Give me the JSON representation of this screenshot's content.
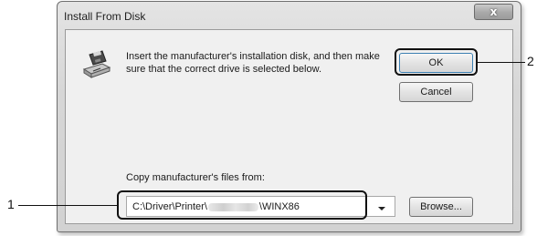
{
  "dialog": {
    "title": "Install From Disk",
    "close_glyph": "x",
    "instruction": "Insert the manufacturer's installation disk, and then make sure that the correct drive is selected below.",
    "ok_label": "OK",
    "cancel_label": "Cancel",
    "copy_label": "Copy manufacturer's files from:",
    "path_prefix": "C:\\Driver\\Printer\\",
    "path_suffix": "\\WINX86",
    "browse_label": "Browse...",
    "icon": "floppy-disk-drive-icon"
  },
  "callouts": {
    "one": "1",
    "two": "2"
  },
  "colors": {
    "ok_focus_border": "#3c7fb1",
    "callout": "#111111"
  }
}
